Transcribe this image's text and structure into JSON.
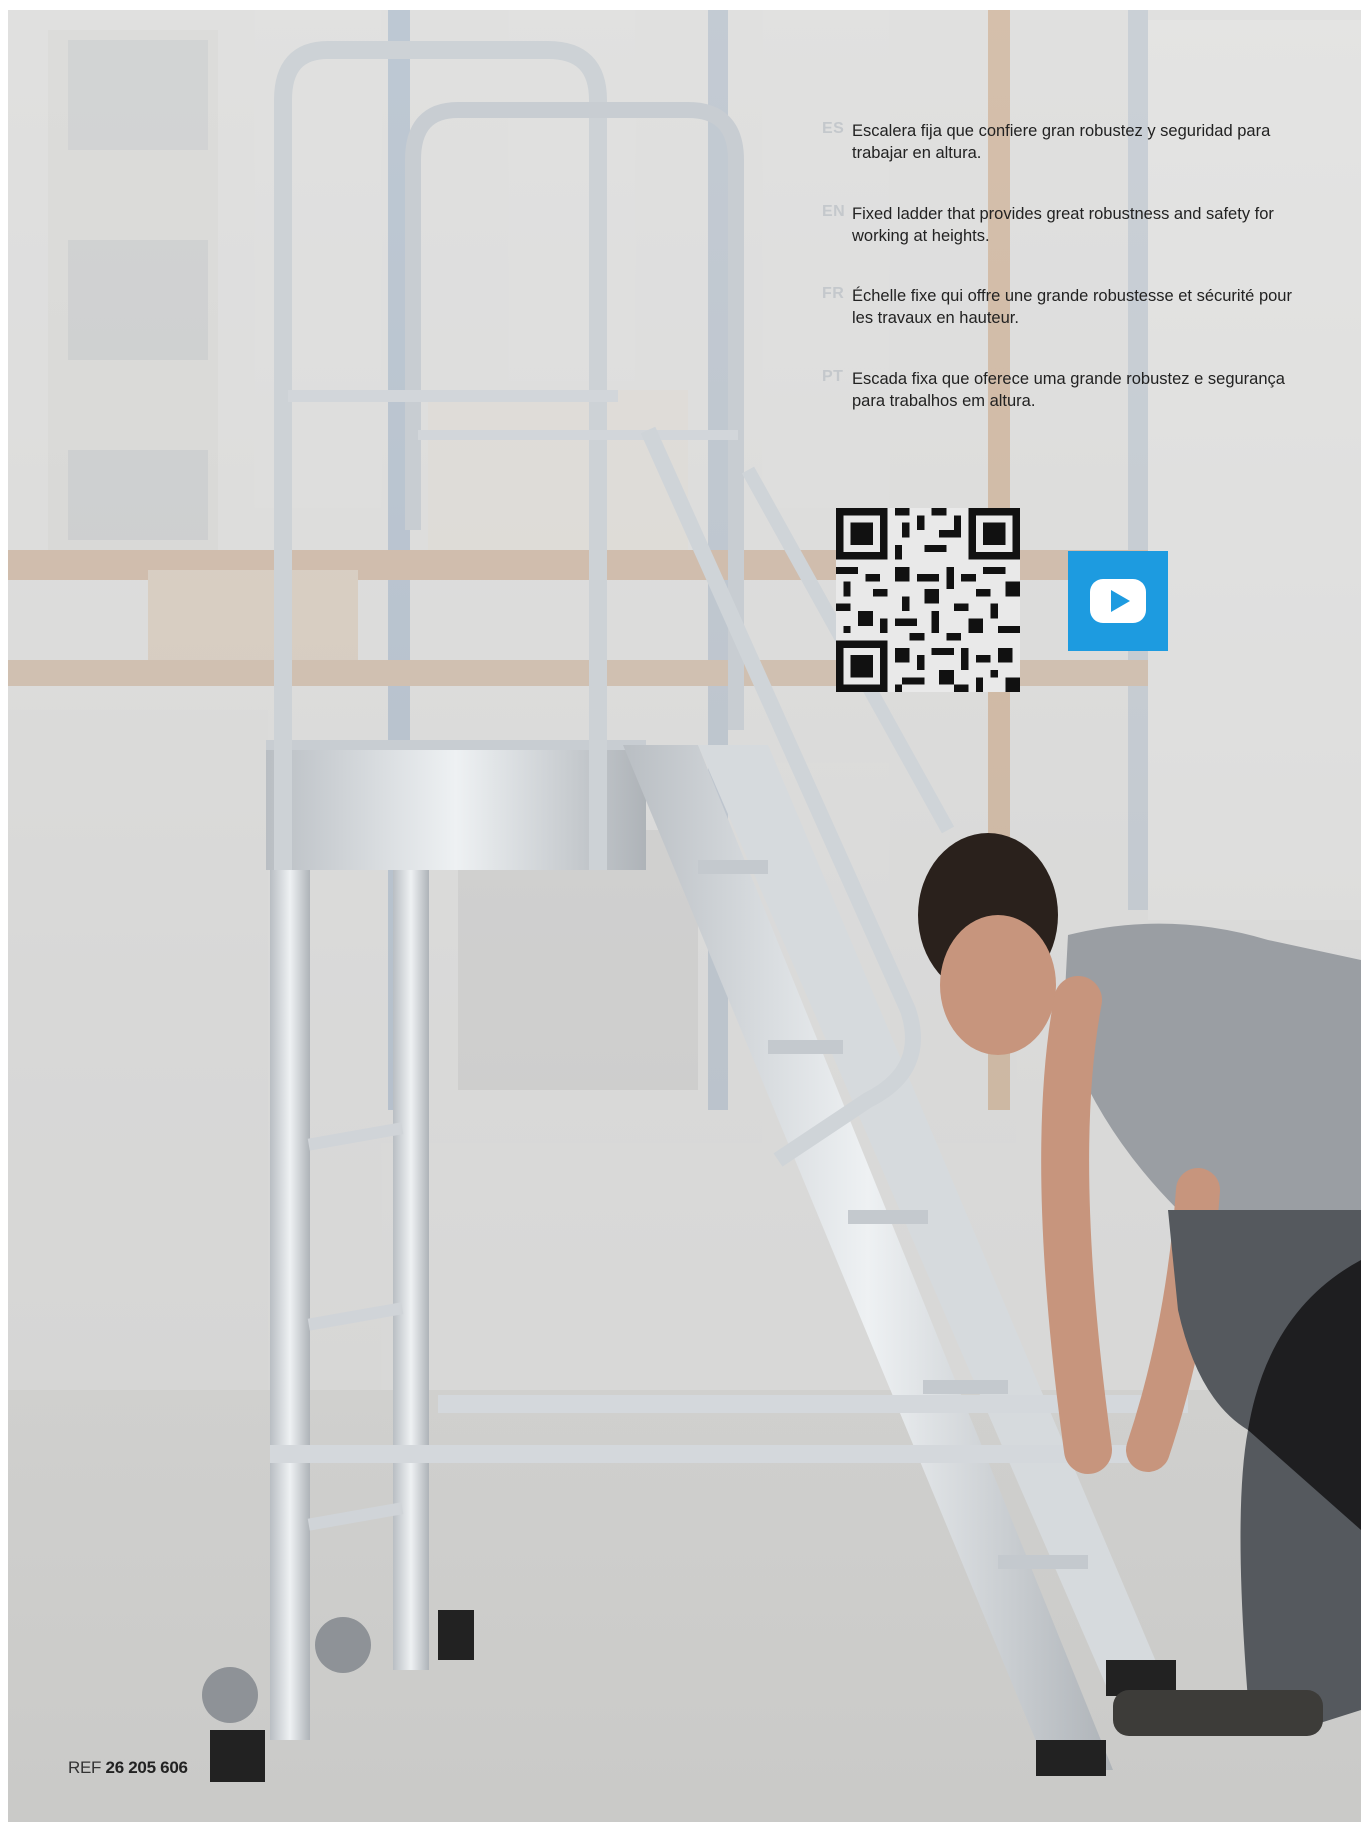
{
  "descriptions": [
    {
      "lang": "ES",
      "text": "Escalera fija que confiere gran robustez y seguridad para trabajar en altura."
    },
    {
      "lang": "EN",
      "text": "Fixed ladder that provides great robustness and safety for working at heights."
    },
    {
      "lang": "FR",
      "text": "Échelle fixe qui offre une grande robustesse et sécurité pour les travaux en hauteur."
    },
    {
      "lang": "PT",
      "text": "Escada fixa que oferece uma grande robustez e segurança para trabalhos em altura."
    }
  ],
  "qr_code": {
    "icon": "qr-code-icon"
  },
  "video_button": {
    "icon": "play-icon",
    "color": "#1d9be0"
  },
  "reference": {
    "prefix": "REF",
    "number": "26 205 606"
  },
  "colors": {
    "code_label": "#c4c8cc",
    "text": "#222222",
    "aluminium": "#d9dde0",
    "shirt": "#9a9ea3"
  }
}
